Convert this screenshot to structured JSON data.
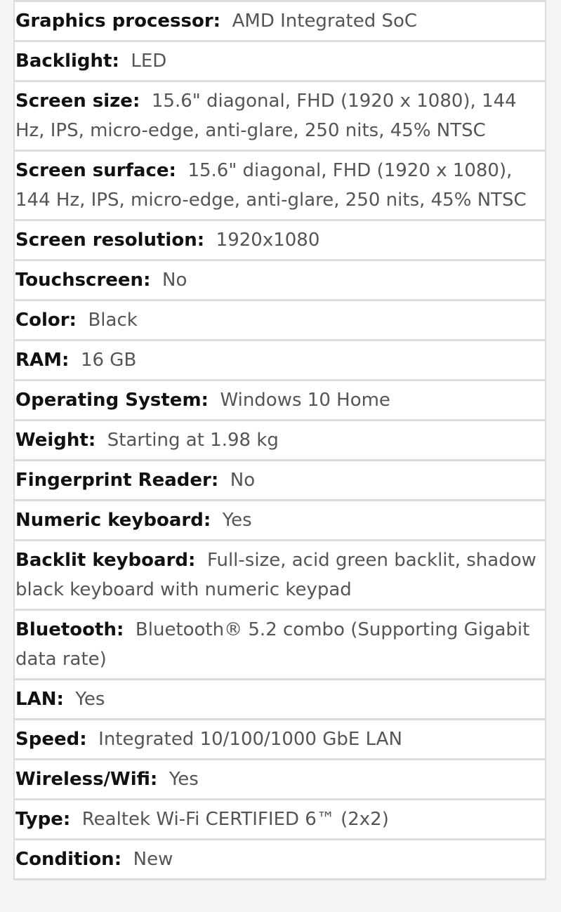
{
  "specs": [
    {
      "label": "Graphics processor:",
      "value": "AMD Integrated SoC"
    },
    {
      "label": "Backlight:",
      "value": "LED"
    },
    {
      "label": "Screen size:",
      "value": "15.6\" diagonal, FHD (1920 x 1080), 144 Hz, IPS, micro-edge, anti-glare, 250 nits, 45% NTSC"
    },
    {
      "label": "Screen surface:",
      "value": "15.6\" diagonal, FHD (1920 x 1080), 144 Hz, IPS, micro-edge, anti-glare, 250 nits, 45% NTSC"
    },
    {
      "label": "Screen resolution:",
      "value": "1920x1080"
    },
    {
      "label": "Touchscreen:",
      "value": "No"
    },
    {
      "label": "Color:",
      "value": "Black"
    },
    {
      "label": "RAM:",
      "value": "16 GB"
    },
    {
      "label": "Operating System:",
      "value": "Windows 10 Home"
    },
    {
      "label": "Weight:",
      "value": "Starting at 1.98 kg"
    },
    {
      "label": "Fingerprint Reader:",
      "value": "No"
    },
    {
      "label": "Numeric keyboard:",
      "value": "Yes"
    },
    {
      "label": "Backlit keyboard:",
      "value": "Full-size, acid green backlit, shadow black keyboard with numeric keypad"
    },
    {
      "label": "Bluetooth:",
      "value": "Bluetooth® 5.2 combo (Supporting Gigabit data rate)"
    },
    {
      "label": "LAN:",
      "value": "Yes"
    },
    {
      "label": "Speed:",
      "value": "Integrated 10/100/1000 GbE LAN"
    },
    {
      "label": "Wireless/Wifi:",
      "value": "Yes"
    },
    {
      "label": "Type:",
      "value": "Realtek Wi-Fi CERTIFIED 6™ (2x2)"
    },
    {
      "label": "Condition:",
      "value": "New"
    }
  ]
}
